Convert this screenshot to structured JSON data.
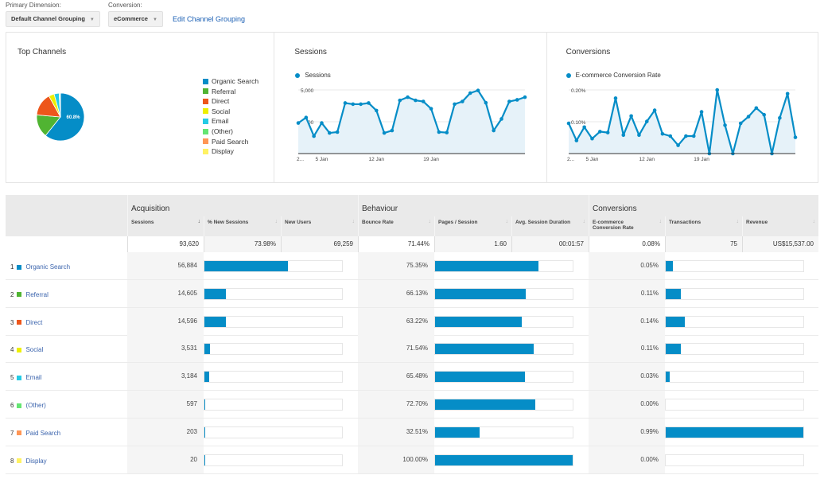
{
  "controls": {
    "primary_dimension_label": "Primary Dimension:",
    "primary_dimension_value": "Default Channel Grouping",
    "conversion_label": "Conversion:",
    "conversion_value": "eCommerce",
    "edit_link": "Edit Channel Grouping"
  },
  "colors": {
    "accent": "#058dc7",
    "organic_search": "#058dc7",
    "referral": "#50b432",
    "direct": "#ed561b",
    "social": "#edef00",
    "email": "#24cbe5",
    "other": "#64e572",
    "paid_search": "#ff9655",
    "display": "#fff263",
    "link": "#3b64ad"
  },
  "chart_data": [
    {
      "type": "pie",
      "title": "Top Channels",
      "categories": [
        "Organic Search",
        "Referral",
        "Direct",
        "Social",
        "Email",
        "(Other)",
        "Paid Search",
        "Display"
      ],
      "values": [
        56884,
        14605,
        14596,
        3531,
        3184,
        597,
        203,
        20
      ],
      "slice_label": "60.8%",
      "legend": "right"
    },
    {
      "type": "area",
      "title": "Sessions",
      "legend_entries": [
        "Sessions"
      ],
      "x_tick_labels": [
        "2...",
        "5 Jan",
        "12 Jan",
        "19 Jan"
      ],
      "y_tick_labels": [
        "5,000",
        "2,500"
      ],
      "ylim": [
        0,
        5000
      ],
      "grid": true,
      "series": [
        {
          "name": "Sessions",
          "values": [
            2400,
            2830,
            1370,
            2400,
            1620,
            1690,
            3970,
            3880,
            3880,
            3970,
            3380,
            1620,
            1810,
            4180,
            4430,
            4180,
            4090,
            3520,
            1690,
            1650,
            3880,
            4090,
            4750,
            4960,
            3990,
            1810,
            2720,
            4090,
            4220,
            4430
          ]
        }
      ]
    },
    {
      "type": "area",
      "title": "Conversions",
      "legend_entries": [
        "E-commerce Conversion Rate"
      ],
      "x_tick_labels": [
        "2...",
        "5 Jan",
        "12 Jan",
        "19 Jan"
      ],
      "y_tick_labels": [
        "0.20%",
        "0.10%"
      ],
      "ylim": [
        0,
        0.2
      ],
      "grid": true,
      "series": [
        {
          "name": "E-commerce Conversion Rate",
          "values": [
            0.095,
            0.041,
            0.083,
            0.047,
            0.069,
            0.066,
            0.174,
            0.058,
            0.118,
            0.058,
            0.101,
            0.136,
            0.062,
            0.055,
            0.026,
            0.055,
            0.055,
            0.131,
            0.0,
            0.2,
            0.089,
            0.0,
            0.095,
            0.116,
            0.143,
            0.122,
            0.0,
            0.112,
            0.188,
            0.051
          ]
        }
      ]
    }
  ],
  "table": {
    "groups": [
      "Acquisition",
      "Behaviour",
      "Conversions"
    ],
    "columns": [
      "Sessions",
      "% New Sessions",
      "New Users",
      "Bounce Rate",
      "Pages / Session",
      "Avg. Session Duration",
      "E-commerce Conversion Rate",
      "Transactions",
      "Revenue"
    ],
    "totals": [
      "93,620",
      "73.98%",
      "69,259",
      "71.44%",
      "1.60",
      "00:01:57",
      "0.08%",
      "75",
      "US$15,537.00"
    ],
    "rows": [
      {
        "index": "1",
        "channel": "Organic Search",
        "color_key": "organic_search",
        "sessions": "56,884",
        "sessions_share": 0.608,
        "bounce": "75.35%",
        "bounce_share": 0.7535,
        "conv": "0.05%",
        "conv_share": 0.0505
      },
      {
        "index": "2",
        "channel": "Referral",
        "color_key": "referral",
        "sessions": "14,605",
        "sessions_share": 0.156,
        "bounce": "66.13%",
        "bounce_share": 0.6613,
        "conv": "0.11%",
        "conv_share": 0.111
      },
      {
        "index": "3",
        "channel": "Direct",
        "color_key": "direct",
        "sessions": "14,596",
        "sessions_share": 0.156,
        "bounce": "63.22%",
        "bounce_share": 0.6322,
        "conv": "0.14%",
        "conv_share": 0.141
      },
      {
        "index": "4",
        "channel": "Social",
        "color_key": "social",
        "sessions": "3,531",
        "sessions_share": 0.038,
        "bounce": "71.54%",
        "bounce_share": 0.7154,
        "conv": "0.11%",
        "conv_share": 0.111
      },
      {
        "index": "5",
        "channel": "Email",
        "color_key": "email",
        "sessions": "3,184",
        "sessions_share": 0.034,
        "bounce": "65.48%",
        "bounce_share": 0.6548,
        "conv": "0.03%",
        "conv_share": 0.0303
      },
      {
        "index": "6",
        "channel": "(Other)",
        "color_key": "other",
        "sessions": "597",
        "sessions_share": 0.0064,
        "bounce": "72.70%",
        "bounce_share": 0.727,
        "conv": "0.00%",
        "conv_share": 0.0
      },
      {
        "index": "7",
        "channel": "Paid Search",
        "color_key": "paid_search",
        "sessions": "203",
        "sessions_share": 0.0022,
        "bounce": "32.51%",
        "bounce_share": 0.3251,
        "conv": "0.99%",
        "conv_share": 1.0
      },
      {
        "index": "8",
        "channel": "Display",
        "color_key": "display",
        "sessions": "20",
        "sessions_share": 0.0002,
        "bounce": "100.00%",
        "bounce_share": 1.0,
        "conv": "0.00%",
        "conv_share": 0.0
      }
    ]
  }
}
